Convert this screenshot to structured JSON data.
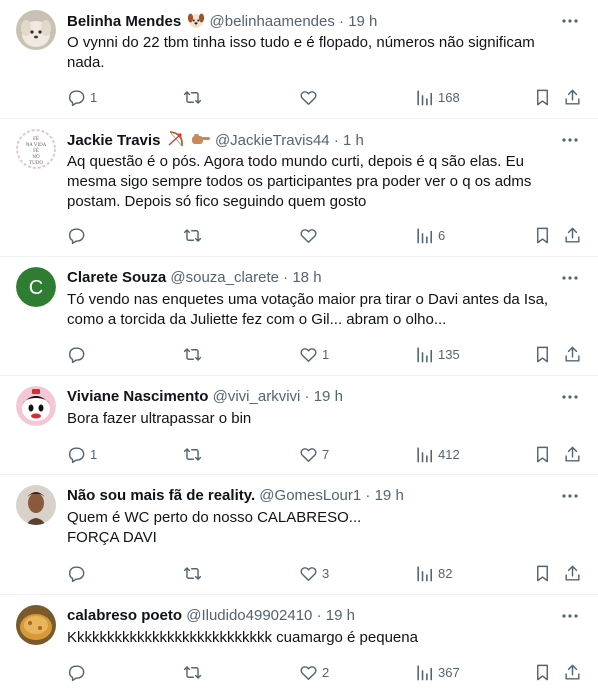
{
  "tweets": [
    {
      "name": "Belinha Mendes",
      "handle": "@belinhaamendes",
      "sep": "·",
      "time": "19 h",
      "text": "O vynni do 22 tbm tinha isso tudo e é flopado, números não significam\nnada.",
      "replies": "1",
      "retweets": "",
      "likes": "",
      "views": "168",
      "avatar": "dog-photo",
      "emoji": "dog-emoji"
    },
    {
      "name": "Jackie Travis",
      "handle": "@JackieTravis44",
      "sep": "·",
      "time": "1 h",
      "text": "Aq questão é o pós. Agora todo mundo curti, depois é q são elas. Eu\nmesma sigo sempre todos os participantes pra poder ver o q os adms\npostam. Depois só fico seguindo quem gosto",
      "replies": "",
      "retweets": "",
      "likes": "",
      "views": "6",
      "avatar": "text-circle",
      "avatar_lines": [
        "FÉ",
        "NA VIDA",
        "FÉ",
        "NO",
        "TUDO"
      ],
      "emoji": "bow-and-hand-emoji"
    },
    {
      "name": "Clarete Souza",
      "handle": "@souza_clarete",
      "sep": "·",
      "time": "18 h",
      "text": "Tó vendo nas enquetes uma votação maior pra tirar o Davi antes da Isa,\ncomo a torcida da Juliette fez com o Gil... abram o olho...",
      "replies": "",
      "retweets": "",
      "likes": "1",
      "views": "135",
      "avatar": "letter",
      "avatar_letter": "C",
      "avatar_color": "#2e7d32"
    },
    {
      "name": "Viviane Nascimento",
      "handle": "@vivi_arkvivi",
      "sep": "·",
      "time": "19 h",
      "text": "Bora fazer ultrapassar o bin",
      "replies": "1",
      "retweets": "",
      "likes": "7",
      "views": "412",
      "avatar": "cartoon-character"
    },
    {
      "name": "Não sou mais fã de reality.",
      "handle": "@GomesLour1",
      "sep": "·",
      "time": "19 h",
      "text": "Quem é WC perto do nosso CALABRESO...\nFORÇA DAVI",
      "replies": "",
      "retweets": "",
      "likes": "3",
      "views": "82",
      "avatar": "person-photo"
    },
    {
      "name": "calabreso poeto",
      "handle": "@Iludido49902410",
      "sep": "·",
      "time": "19 h",
      "text": "Kkkkkkkkkkkkkkkkkkkkkkkkkkk cuamargo é pequena",
      "replies": "",
      "retweets": "",
      "likes": "2",
      "views": "367",
      "avatar": "food-photo"
    }
  ],
  "colors": {
    "text": "#0f1419",
    "secondary": "#536471",
    "divider": "#eff3f4"
  }
}
